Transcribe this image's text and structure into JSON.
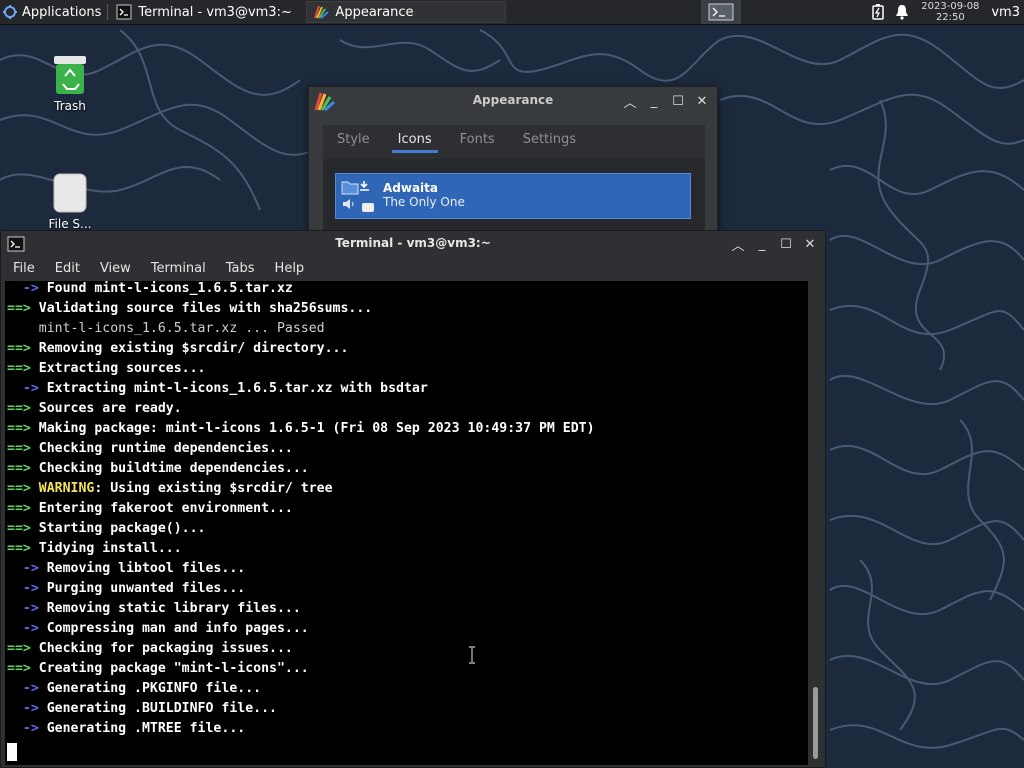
{
  "panel": {
    "applications_label": "Applications",
    "tasks": [
      {
        "label": "Terminal - vm3@vm3:~"
      },
      {
        "label": "Appearance"
      }
    ],
    "clock_date": "2023-09-08",
    "clock_time": "22:50",
    "user": "vm3"
  },
  "desktop": {
    "icons": [
      {
        "label": "Trash"
      },
      {
        "label": "File S..."
      }
    ]
  },
  "appearance": {
    "title": "Appearance",
    "tabs": [
      "Style",
      "Icons",
      "Fonts",
      "Settings"
    ],
    "active_tab": "Icons",
    "selected_theme": {
      "name": "Adwaita",
      "description": "The Only One"
    }
  },
  "terminal": {
    "title": "Terminal - vm3@vm3:~",
    "menu": [
      "File",
      "Edit",
      "View",
      "Terminal",
      "Tabs",
      "Help"
    ],
    "lines": [
      {
        "prefix": "  -> ",
        "kind": "b",
        "text": "Found mint-l-icons_1.6.5.tar.xz"
      },
      {
        "prefix": "==> ",
        "kind": "g",
        "text": "Validating source files with sha256sums..."
      },
      {
        "prefix": "    ",
        "kind": "d",
        "text": "mint-l-icons_1.6.5.tar.xz ... Passed"
      },
      {
        "prefix": "==> ",
        "kind": "g",
        "text": "Removing existing $srcdir/ directory..."
      },
      {
        "prefix": "==> ",
        "kind": "g",
        "text": "Extracting sources..."
      },
      {
        "prefix": "  -> ",
        "kind": "b",
        "text": "Extracting mint-l-icons_1.6.5.tar.xz with bsdtar"
      },
      {
        "prefix": "==> ",
        "kind": "g",
        "text": "Sources are ready."
      },
      {
        "prefix": "==> ",
        "kind": "g",
        "text": "Making package: mint-l-icons 1.6.5-1 (Fri 08 Sep 2023 10:49:37 PM EDT)"
      },
      {
        "prefix": "==> ",
        "kind": "g",
        "text": "Checking runtime dependencies..."
      },
      {
        "prefix": "==> ",
        "kind": "g",
        "text": "Checking buildtime dependencies..."
      },
      {
        "prefix": "==> ",
        "kind": "warn",
        "text": ": Using existing $srcdir/ tree",
        "warn": "WARNING"
      },
      {
        "prefix": "==> ",
        "kind": "g",
        "text": "Entering fakeroot environment..."
      },
      {
        "prefix": "==> ",
        "kind": "g",
        "text": "Starting package()..."
      },
      {
        "prefix": "==> ",
        "kind": "g",
        "text": "Tidying install..."
      },
      {
        "prefix": "  -> ",
        "kind": "b",
        "text": "Removing libtool files..."
      },
      {
        "prefix": "  -> ",
        "kind": "b",
        "text": "Purging unwanted files..."
      },
      {
        "prefix": "  -> ",
        "kind": "b",
        "text": "Removing static library files..."
      },
      {
        "prefix": "  -> ",
        "kind": "b",
        "text": "Compressing man and info pages..."
      },
      {
        "prefix": "==> ",
        "kind": "g",
        "text": "Checking for packaging issues..."
      },
      {
        "prefix": "==> ",
        "kind": "g",
        "text": "Creating package \"mint-l-icons\"..."
      },
      {
        "prefix": "  -> ",
        "kind": "b",
        "text": "Generating .PKGINFO file..."
      },
      {
        "prefix": "  -> ",
        "kind": "b",
        "text": "Generating .BUILDINFO file..."
      },
      {
        "prefix": "  -> ",
        "kind": "b",
        "text": "Generating .MTREE file..."
      }
    ]
  },
  "colors": {
    "accent": "#3f7fd1",
    "prompt_green": "#5fd75f",
    "arrow_blue": "#5c6cf2",
    "warning_yellow": "#f2e35a"
  }
}
